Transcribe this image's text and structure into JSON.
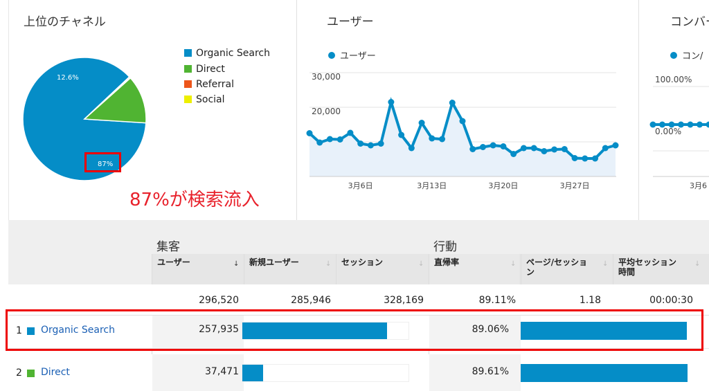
{
  "channels_card": {
    "title": "上位のチャネル",
    "legend": [
      {
        "label": "Organic Search",
        "color": "#058dc7"
      },
      {
        "label": "Direct",
        "color": "#50b432"
      },
      {
        "label": "Referral",
        "color": "#ed561b"
      },
      {
        "label": "Social",
        "color": "#edef00"
      }
    ],
    "pie_label_organic": "87%",
    "pie_label_direct": "12.6%",
    "annotation": "87%が検索流入"
  },
  "users_card": {
    "title": "ユーザー",
    "legend": "ユーザー"
  },
  "conversion_card": {
    "title": "コンバー",
    "legend": "コン/",
    "ticks_y": [
      "100.00%",
      "0.00%"
    ],
    "tick_x": "3月6"
  },
  "chart_data": [
    {
      "type": "pie",
      "categories": [
        "Organic Search",
        "Direct",
        "Referral",
        "Social"
      ],
      "values": [
        87,
        12.6,
        0.3,
        0.1
      ],
      "data_labels": [
        "87%",
        "12.6%"
      ]
    },
    {
      "type": "line",
      "series": [
        {
          "name": "ユーザー",
          "color": "#058dc7",
          "values": [
            12500,
            9800,
            10800,
            10700,
            12600,
            9500,
            9000,
            9500,
            21500,
            12000,
            8200,
            15500,
            11000,
            10800,
            21300,
            16000,
            7900,
            8500,
            9000,
            8700,
            6500,
            8200,
            8200,
            7300,
            7800,
            7900,
            5300,
            5200,
            5200,
            8200,
            9000
          ]
        }
      ],
      "x": [
        "3月1日",
        "3月2日",
        "3月3日",
        "3月4日",
        "3月5日",
        "3月6日",
        "3月7日",
        "3月8日",
        "3月9日",
        "3月10日",
        "3月11日",
        "3月12日",
        "3月13日",
        "3月14日",
        "3月15日",
        "3月16日",
        "3月17日",
        "3月18日",
        "3月19日",
        "3月20日",
        "3月21日",
        "3月22日",
        "3月23日",
        "3月24日",
        "3月25日",
        "3月26日",
        "3月27日",
        "3月28日",
        "3月29日",
        "3月30日",
        "3月31日"
      ],
      "x_tick_labels": [
        "3月6日",
        "3月13日",
        "3月20日",
        "3月27日"
      ],
      "y_tick_labels": [
        "30,000",
        "20,000",
        "10,000"
      ],
      "ylim": [
        0,
        30000
      ]
    },
    {
      "type": "line",
      "series": [
        {
          "name": "コン",
          "color": "#058dc7",
          "values": [
            0,
            0,
            0,
            0,
            0,
            0,
            0
          ]
        }
      ],
      "ylim": [
        0,
        1
      ]
    }
  ],
  "table": {
    "group_acquisition": "集客",
    "group_behavior": "行動",
    "headers": [
      "ユーザー",
      "新規ユーザー",
      "セッション",
      "直帰率",
      "ページ/セッショ\nン",
      "平均セッション\n時間"
    ],
    "sort_arrow": "↓",
    "sortable_arrow": "↓",
    "totals": [
      "296,520",
      "285,946",
      "328,169",
      "89.11%",
      "1.18",
      "00:00:30"
    ],
    "rows": [
      {
        "index": "1",
        "channel": "Organic Search",
        "color": "#058dc7",
        "users": "257,935",
        "new_users_fraction": 0.87,
        "bounce": "89.06%",
        "bounce_fraction": 0.9906
      },
      {
        "index": "2",
        "channel": "Direct",
        "color": "#50b432",
        "users": "37,471",
        "new_users_fraction": 0.126,
        "bounce": "89.61%",
        "bounce_fraction": 0.9961
      }
    ]
  }
}
